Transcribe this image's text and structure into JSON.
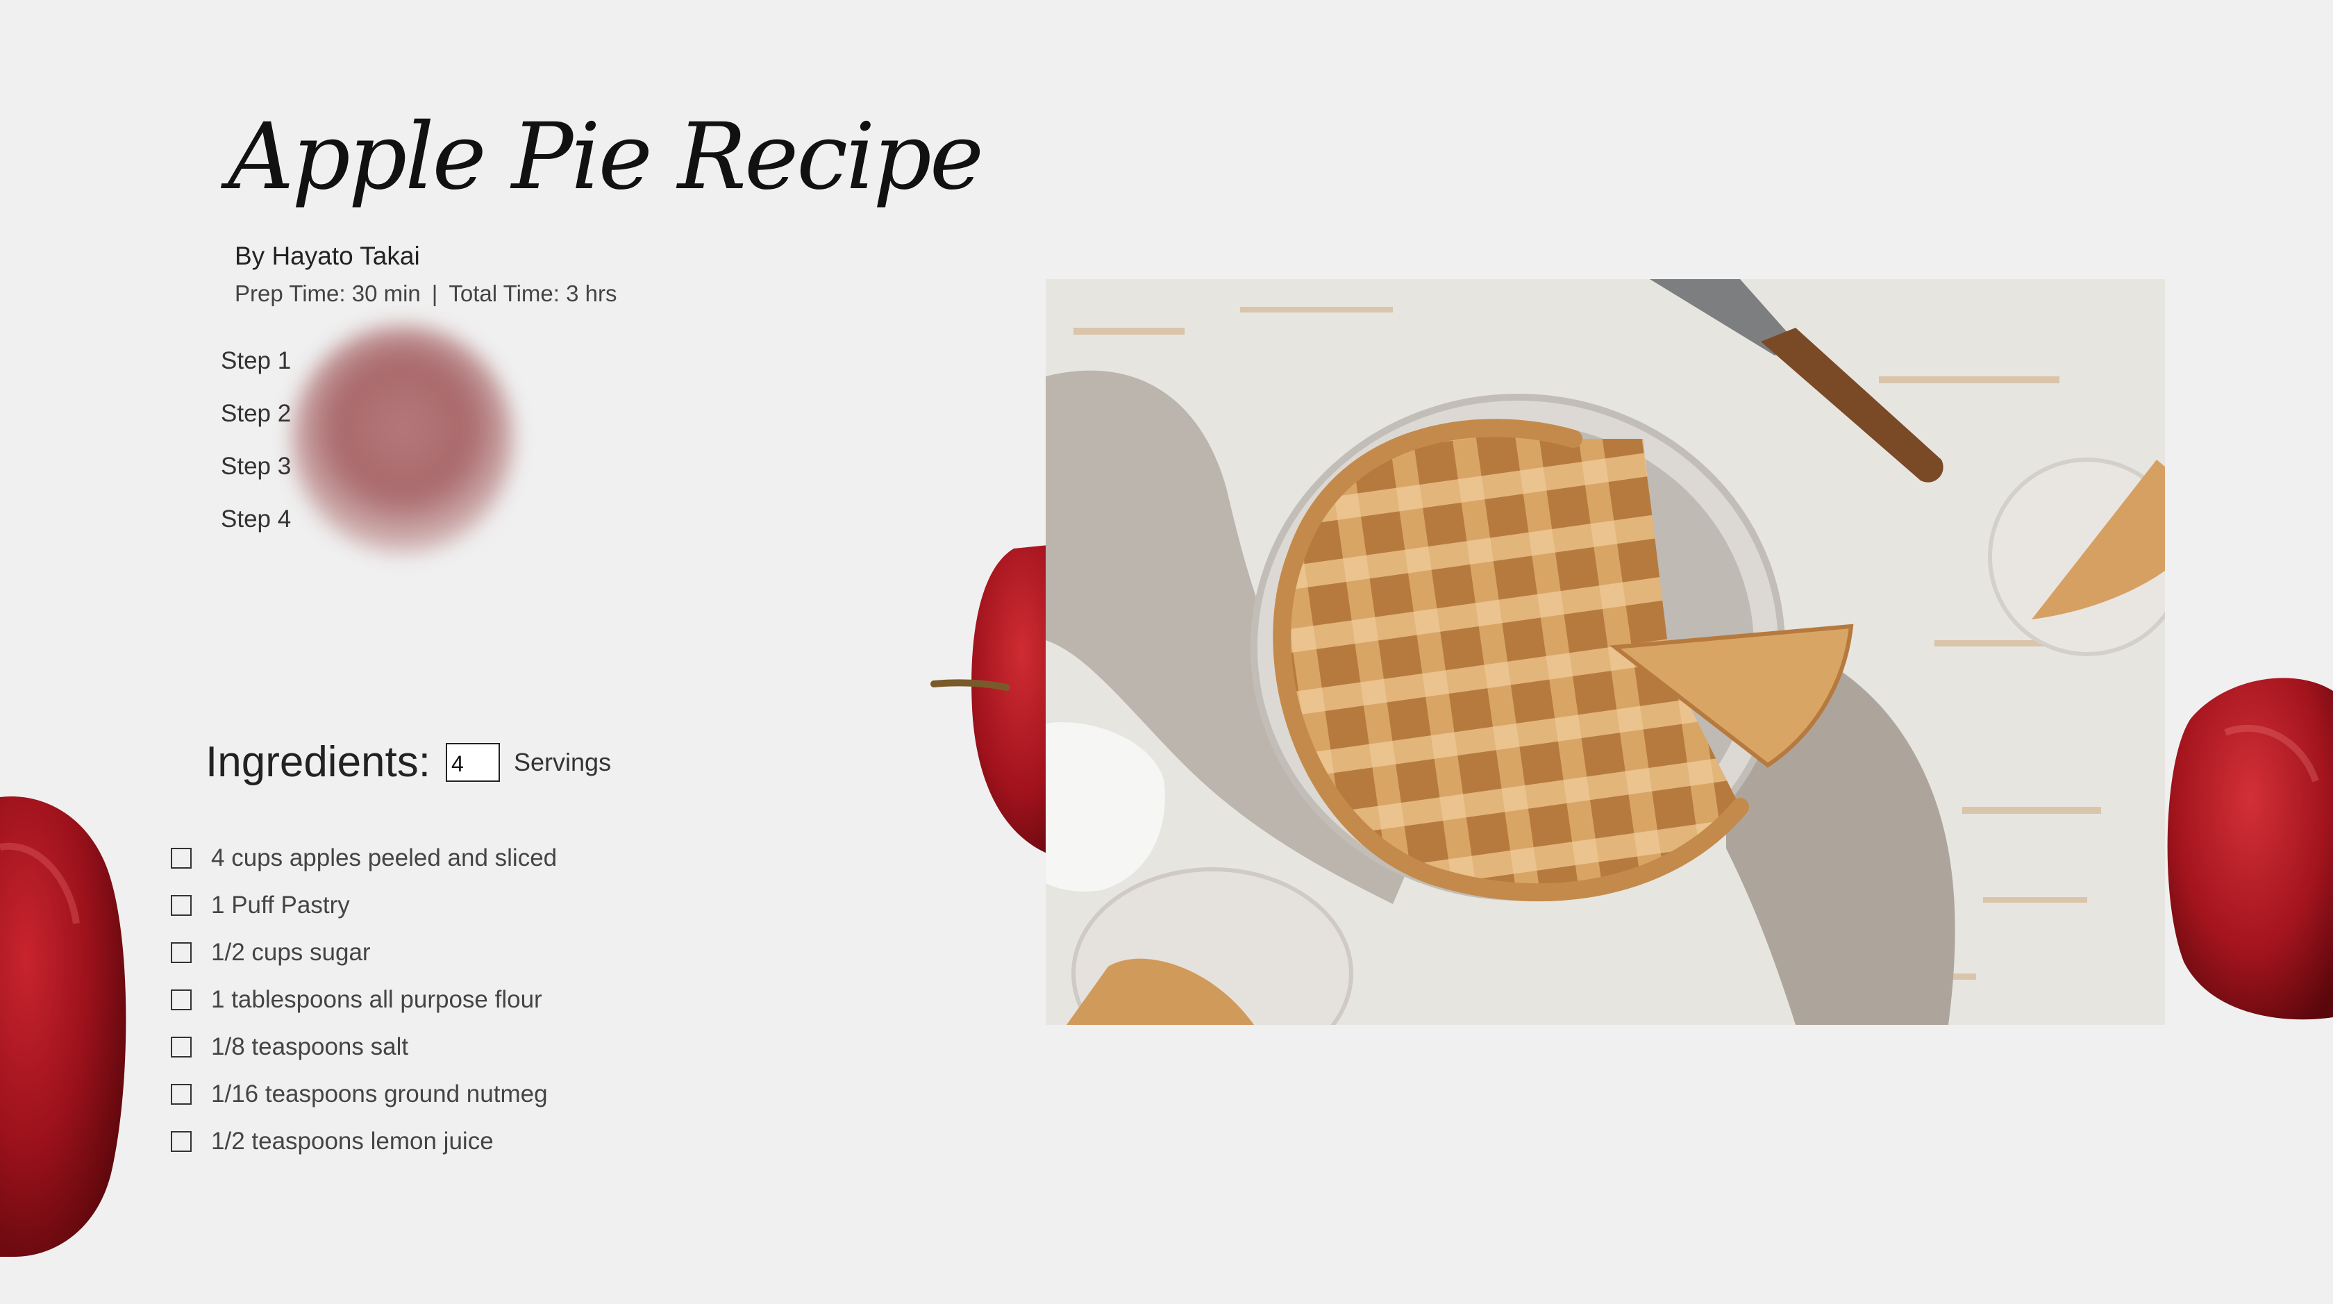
{
  "recipe": {
    "title": "Apple Pie Recipe",
    "author": "By Hayato Takai",
    "prep_time": "Prep Time: 30 min",
    "separator": "|",
    "total_time": "Total Time: 3 hrs"
  },
  "steps": [
    {
      "label": "Step 1"
    },
    {
      "label": "Step 2"
    },
    {
      "label": "Step 3"
    },
    {
      "label": "Step 4"
    }
  ],
  "ingredients": {
    "heading": "Ingredients:",
    "servings_value": "4",
    "servings_label": "Servings",
    "items": [
      {
        "text": "4 cups apples peeled and sliced",
        "checked": false
      },
      {
        "text": "1 Puff Pastry",
        "checked": false
      },
      {
        "text": "1/2 cups sugar",
        "checked": false
      },
      {
        "text": "1 tablespoons all purpose flour",
        "checked": false
      },
      {
        "text": "1/8 teaspoons salt",
        "checked": false
      },
      {
        "text": "1/16 teaspoons ground nutmeg",
        "checked": false
      },
      {
        "text": "1/2 teaspoons lemon juice",
        "checked": false
      }
    ]
  },
  "colors": {
    "background": "#f0f0f0",
    "apple_red": "#a3141d",
    "text": "#222222"
  }
}
